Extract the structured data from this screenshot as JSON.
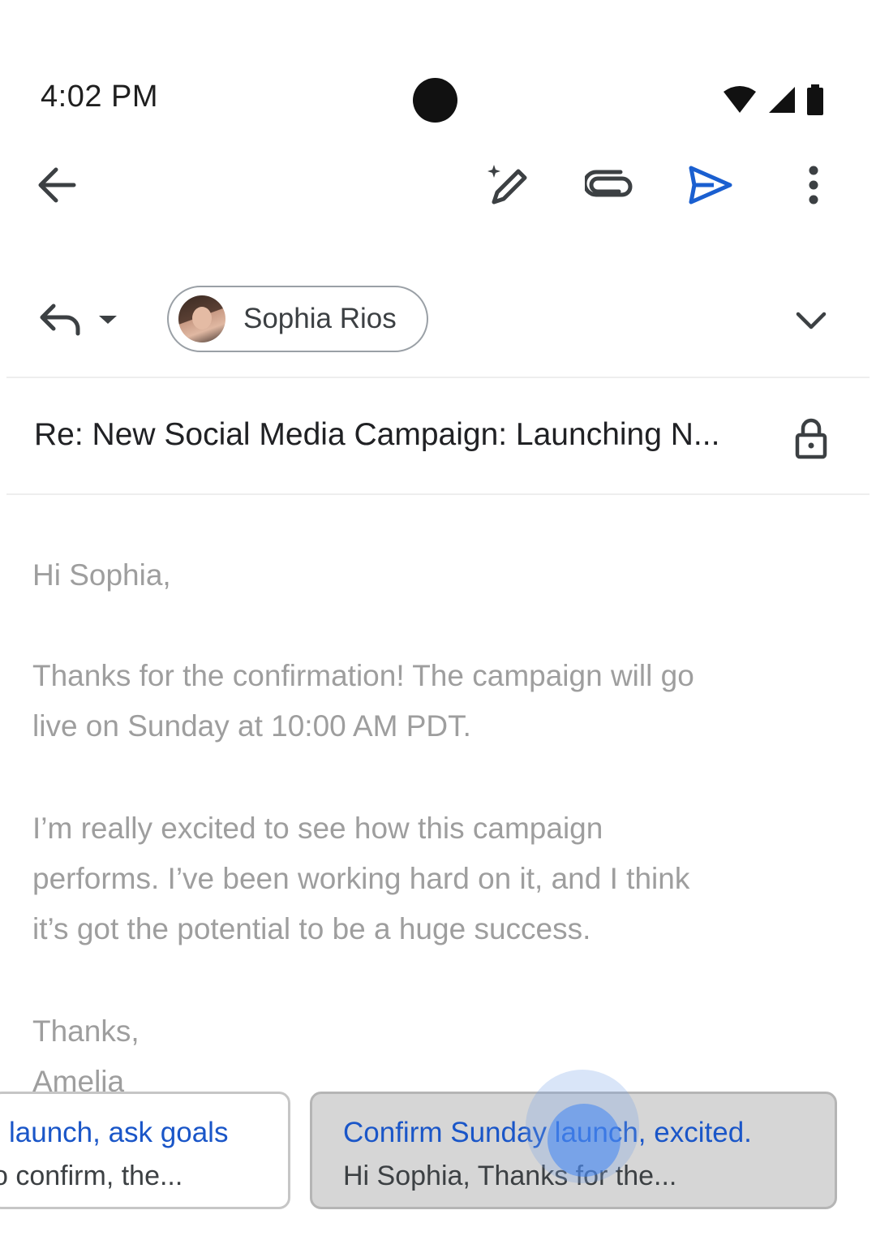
{
  "status_bar": {
    "time": "4:02 PM"
  },
  "toolbar": {
    "back": "arrow-left-icon",
    "magic": "pen-sparkle-icon",
    "attach": "paperclip-icon",
    "send": "send-icon",
    "more": "more-vert-icon"
  },
  "recipient": {
    "name": "Sophia Rios"
  },
  "subject": "Re: New Social Media Campaign: Launching N...",
  "body": {
    "greeting": "Hi Sophia,",
    "paragraph1_line1": "Thanks for the confirmation! The campaign will go",
    "paragraph1_line2": "live on Sunday at 10:00 AM PDT.",
    "paragraph2_line1": "I’m really excited to see how this campaign",
    "paragraph2_line2": "performs. I’ve been working hard on it, and I think",
    "paragraph2_line3": "it’s got the potential to be a huge success.",
    "signoff": "Thanks,",
    "signature": "Amelia"
  },
  "suggestions": [
    {
      "title": "launch, ask goals",
      "preview": "o confirm, the..."
    },
    {
      "title": "Confirm Sunday launch, excited.",
      "preview": "Hi Sophia, Thanks for the..."
    }
  ],
  "colors": {
    "accent": "#1a56c8",
    "body_text": "#9e9e9e"
  }
}
